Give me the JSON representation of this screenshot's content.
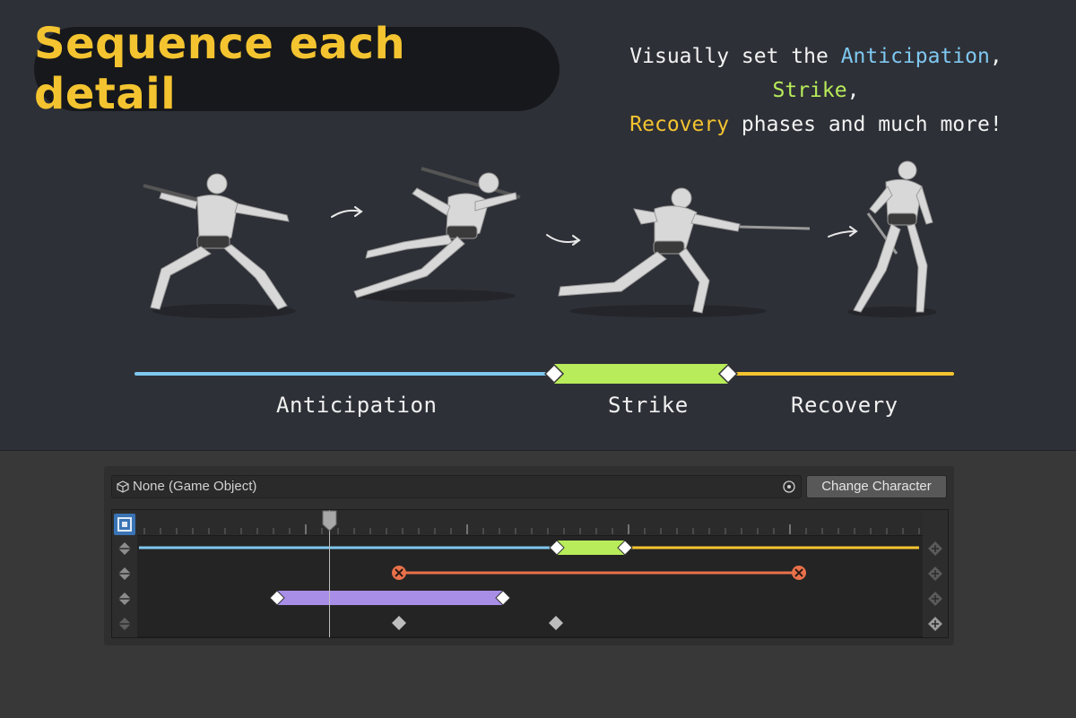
{
  "hero": {
    "title": "Sequence each detail",
    "tagline": {
      "part1": "Visually set the ",
      "anticipation": "Anticipation",
      "sep1": ", ",
      "strike": "Strike",
      "sep2": ",",
      "recovery": "Recovery",
      "part2": " phases and much more!"
    },
    "phases": {
      "anticipation": "Anticipation",
      "strike": "Strike",
      "recovery": "Recovery"
    }
  },
  "colors": {
    "anticipation": "#7fc8f0",
    "strike": "#b8ec5a",
    "recovery": "#f4c430",
    "cancel": "#e8714a",
    "range": "#a98ee8",
    "accent": "#3a74b5"
  },
  "editor": {
    "object_field": "None (Game Object)",
    "change_button": "Change Character"
  }
}
